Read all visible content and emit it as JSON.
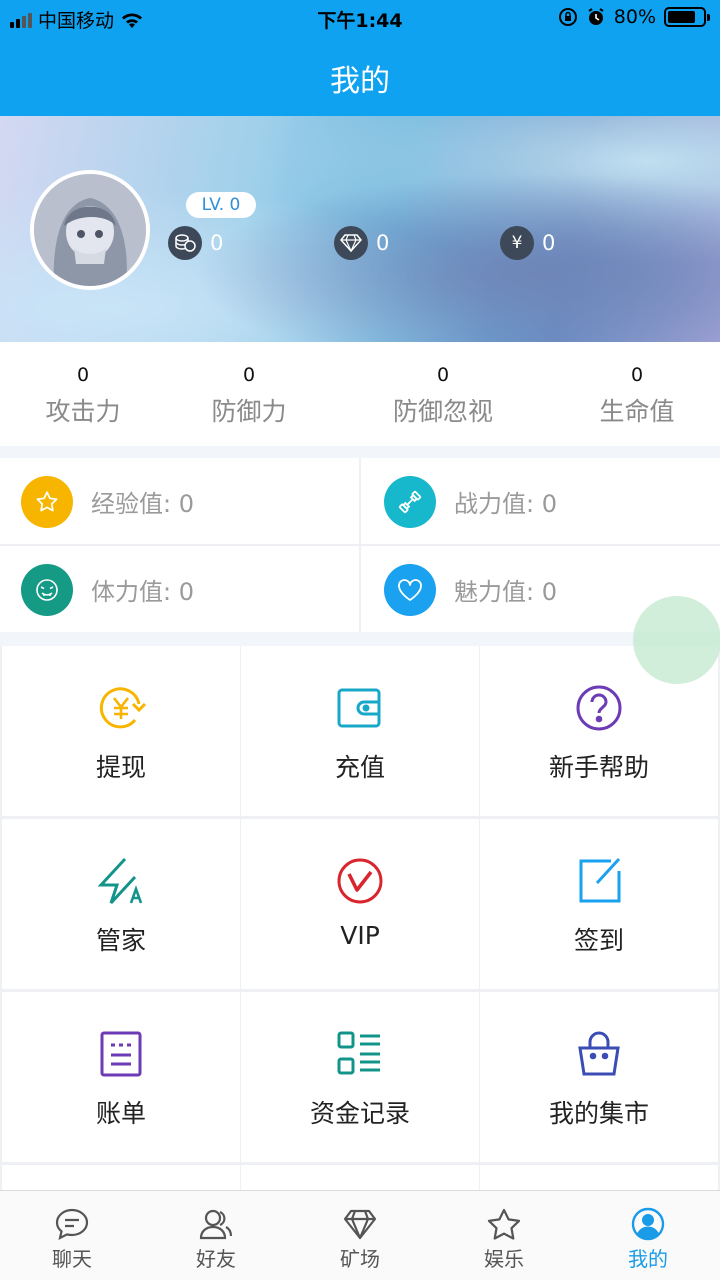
{
  "status_bar": {
    "carrier": "中国移动",
    "time": "下午1:44",
    "battery": "80%",
    "battery_level": 0.8
  },
  "header": {
    "title": "我的"
  },
  "profile": {
    "level": "LV. 0",
    "coins": "0",
    "diamonds": "0",
    "yuan": "0"
  },
  "attributes": [
    {
      "value": "0",
      "label": "攻击力"
    },
    {
      "value": "0",
      "label": "防御力"
    },
    {
      "value": "0",
      "label": "防御忽视"
    },
    {
      "value": "0",
      "label": "生命值"
    }
  ],
  "values": [
    {
      "label": "经验值: 0",
      "icon": "star-icon",
      "color": "#f7b500"
    },
    {
      "label": "战力值: 0",
      "icon": "dumbbell-icon",
      "color": "#18b8cc"
    },
    {
      "label": "体力值: 0",
      "icon": "face-icon",
      "color": "#159a86"
    },
    {
      "label": "魅力值: 0",
      "icon": "heart-icon",
      "color": "#1aa1f0"
    }
  ],
  "menu": [
    {
      "label": "提现",
      "icon": "withdraw-icon",
      "color": "#f7b500"
    },
    {
      "label": "充值",
      "icon": "wallet-icon",
      "color": "#17a8c8"
    },
    {
      "label": "新手帮助",
      "icon": "help-icon",
      "color": "#6d3bb5"
    },
    {
      "label": "管家",
      "icon": "butler-icon",
      "color": "#13948a"
    },
    {
      "label": "VIP",
      "icon": "vip-icon",
      "color": "#d9262e"
    },
    {
      "label": "签到",
      "icon": "checkin-icon",
      "color": "#1aa1f0"
    },
    {
      "label": "账单",
      "icon": "bill-icon",
      "color": "#6d3bb5"
    },
    {
      "label": "资金记录",
      "icon": "record-icon",
      "color": "#13948a"
    },
    {
      "label": "我的集市",
      "icon": "market-icon",
      "color": "#3b4db5"
    }
  ],
  "tabs": [
    {
      "label": "聊天",
      "icon": "chat-icon"
    },
    {
      "label": "好友",
      "icon": "friends-icon"
    },
    {
      "label": "矿场",
      "icon": "diamond-icon"
    },
    {
      "label": "娱乐",
      "icon": "star-outline-icon"
    },
    {
      "label": "我的",
      "icon": "user-icon",
      "active": true
    }
  ],
  "colors": {
    "accent": "#0ea2f0",
    "tab_active": "#1a9be8"
  }
}
